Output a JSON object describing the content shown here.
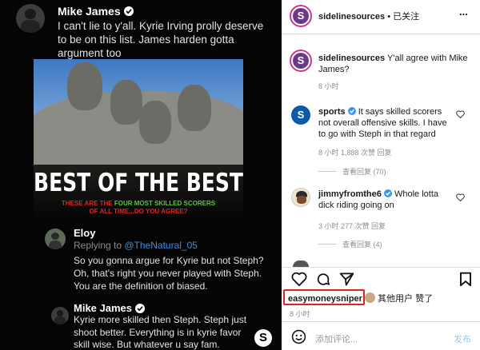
{
  "tweet1": {
    "name": "Mike James",
    "text": "I can't lie to y'all. Kyrie Irving prolly deserve to be on this list. James harden gotta argument too"
  },
  "poster": {
    "title": "BEST OF THE BEST",
    "sub1_pre": "THESE ARE THE ",
    "sub1_hl": "FOUR MOST SKILLED SCORERS",
    "sub2": "OF ALL TIME...DO YOU AGREE?"
  },
  "reply1": {
    "name": "Eloy",
    "replying_prefix": "Replying to ",
    "replying_handle": "@TheNatural_05",
    "text": "So you gonna argue for Kyrie but not Steph? Oh, that's right you never played with Steph. You are the definition of biased."
  },
  "reply2": {
    "name": "Mike James",
    "text": "Kyrie more skilled then Steph. Steph just shoot better. Everything is in kyrie favor skill wise. But whatever u say fam."
  },
  "left_logo": "S",
  "ig": {
    "header_user": "sidelinesources",
    "header_suffix": " • 已关注",
    "more": "...",
    "caption_user": "sidelinesources",
    "caption_text": " Y'all agree with Mike James?",
    "caption_time": "8 小时",
    "comments": [
      {
        "user": "sports",
        "text": " It says skilled scorers not overall offensive skills. I have to go with Steph in that regard",
        "meta": "8 小时   1,888 次赞   回复",
        "view_replies": "查看回复 (70)"
      },
      {
        "user": "jimmyfromthe6",
        "text": " Whole lotta dick riding going on",
        "meta": "3 小时   277 次赞   回复",
        "view_replies": "查看回复 (4)"
      }
    ],
    "likes_user": "easymoneysniper",
    "likes_text": " 其他用户 赞了",
    "likes_ago": "8 小时",
    "add_comment": "添加评论...",
    "post_label": "发布"
  },
  "colors": {
    "twitter_bg": "#050505",
    "link_blue": "#3a8fe0",
    "highlight_red": "#e2231a",
    "poster_red": "#d12a2a",
    "poster_green": "#58c53a"
  }
}
